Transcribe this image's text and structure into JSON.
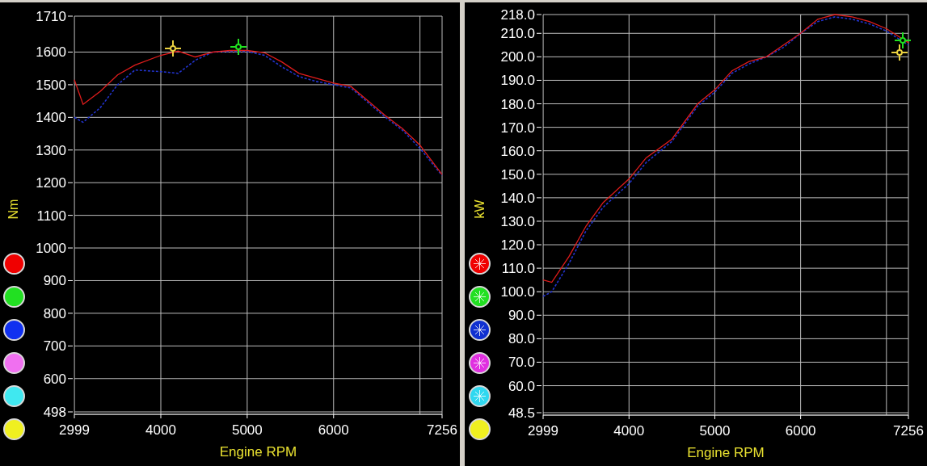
{
  "panels": [
    {
      "chart_data": {
        "type": "line",
        "xlabel": "Engine RPM",
        "ylabel": "Nm",
        "grid": true,
        "x": [
          2999,
          3100,
          3300,
          3500,
          3700,
          4000,
          4200,
          4400,
          4600,
          4800,
          5000,
          5200,
          5400,
          5600,
          5800,
          6000,
          6200,
          6400,
          6600,
          6800,
          7000,
          7256
        ],
        "series": [
          {
            "color": "#e01c1c",
            "line_style": "solid",
            "values": [
              1515,
              1440,
              1480,
              1530,
              1560,
              1590,
              1603,
              1585,
              1600,
              1605,
              1605,
              1598,
              1570,
              1535,
              1520,
              1505,
              1495,
              1450,
              1405,
              1365,
              1315,
              1225
            ]
          },
          {
            "color": "#2233cc",
            "line_style": "dashed",
            "values": [
              1400,
              1385,
              1430,
              1500,
              1545,
              1540,
              1535,
              1575,
              1600,
              1602,
              1602,
              1590,
              1555,
              1525,
              1510,
              1500,
              1490,
              1445,
              1400,
              1360,
              1305,
              1222
            ]
          }
        ],
        "xlim": [
          2999,
          7256
        ],
        "ylim": [
          498,
          1710
        ],
        "xticks": [
          2999,
          4000,
          5000,
          6000,
          7256
        ],
        "yticks": [
          498,
          600,
          700,
          800,
          900,
          1000,
          1100,
          1200,
          1300,
          1400,
          1500,
          1600,
          1710
        ]
      },
      "cursors": [
        {
          "color": "#e8d040"
        },
        {
          "color": "#20e020"
        }
      ],
      "legend": [
        {
          "color": "#f00000",
          "marked": false
        },
        {
          "color": "#22e022",
          "marked": false
        },
        {
          "color": "#1030f0",
          "marked": false
        },
        {
          "color": "#f070f0",
          "marked": false
        },
        {
          "color": "#40e8f0",
          "marked": false
        },
        {
          "color": "#f0f020",
          "marked": false
        }
      ]
    },
    {
      "chart_data": {
        "type": "line",
        "xlabel": "Engine RPM",
        "ylabel": "kW",
        "grid": true,
        "x": [
          2999,
          3100,
          3300,
          3500,
          3700,
          4000,
          4200,
          4500,
          4800,
          5000,
          5200,
          5400,
          5600,
          5800,
          6000,
          6200,
          6400,
          6600,
          6800,
          7000,
          7256
        ],
        "series": [
          {
            "color": "#e01c1c",
            "line_style": "solid",
            "values": [
              105,
              104,
              115,
              128,
              138,
              148,
              157,
              165,
              180,
              186,
              194,
              198,
              200,
              205,
              210,
              216,
              218,
              217,
              215,
              212,
              206
            ]
          },
          {
            "color": "#2233cc",
            "line_style": "dashed",
            "values": [
              98,
              100,
              112,
              126,
              136,
              146,
              155,
              164,
              179,
              185,
              193,
              197,
              200,
              204,
              210,
              215,
              217,
              216,
              214,
              211,
              205
            ]
          }
        ],
        "xlim": [
          2999,
          7256
        ],
        "ylim": [
          48.5,
          218
        ],
        "xticks": [
          2999,
          4000,
          5000,
          6000,
          7256
        ],
        "yticks": [
          {
            "value": 48.5,
            "label": "48.5"
          },
          {
            "value": 60,
            "label": "60.0"
          },
          {
            "value": 70,
            "label": "70.0"
          },
          {
            "value": 80,
            "label": "80.0"
          },
          {
            "value": 90,
            "label": "90.0"
          },
          {
            "value": 100,
            "label": "100.0"
          },
          {
            "value": 110,
            "label": "110.0"
          },
          {
            "value": 120,
            "label": "120.0"
          },
          {
            "value": 130,
            "label": "130.0"
          },
          {
            "value": 140,
            "label": "140.0"
          },
          {
            "value": 150,
            "label": "150.0"
          },
          {
            "value": 160,
            "label": "160.0"
          },
          {
            "value": 170,
            "label": "170.0"
          },
          {
            "value": 180,
            "label": "180.0"
          },
          {
            "value": 190,
            "label": "190.0"
          },
          {
            "value": 200,
            "label": "200.0"
          },
          {
            "value": 210,
            "label": "210.0"
          },
          {
            "value": 218,
            "label": "218.0"
          }
        ]
      },
      "cursors": [
        {
          "color": "#20e020"
        },
        {
          "color": "#e8d040"
        }
      ],
      "legend": [
        {
          "color": "#f00000",
          "marked": true
        },
        {
          "color": "#22e022",
          "marked": true
        },
        {
          "color": "#1030d0",
          "marked": true
        },
        {
          "color": "#e030e0",
          "marked": true
        },
        {
          "color": "#30d8f0",
          "marked": true
        },
        {
          "color": "#f0f020",
          "marked": false
        }
      ]
    }
  ]
}
